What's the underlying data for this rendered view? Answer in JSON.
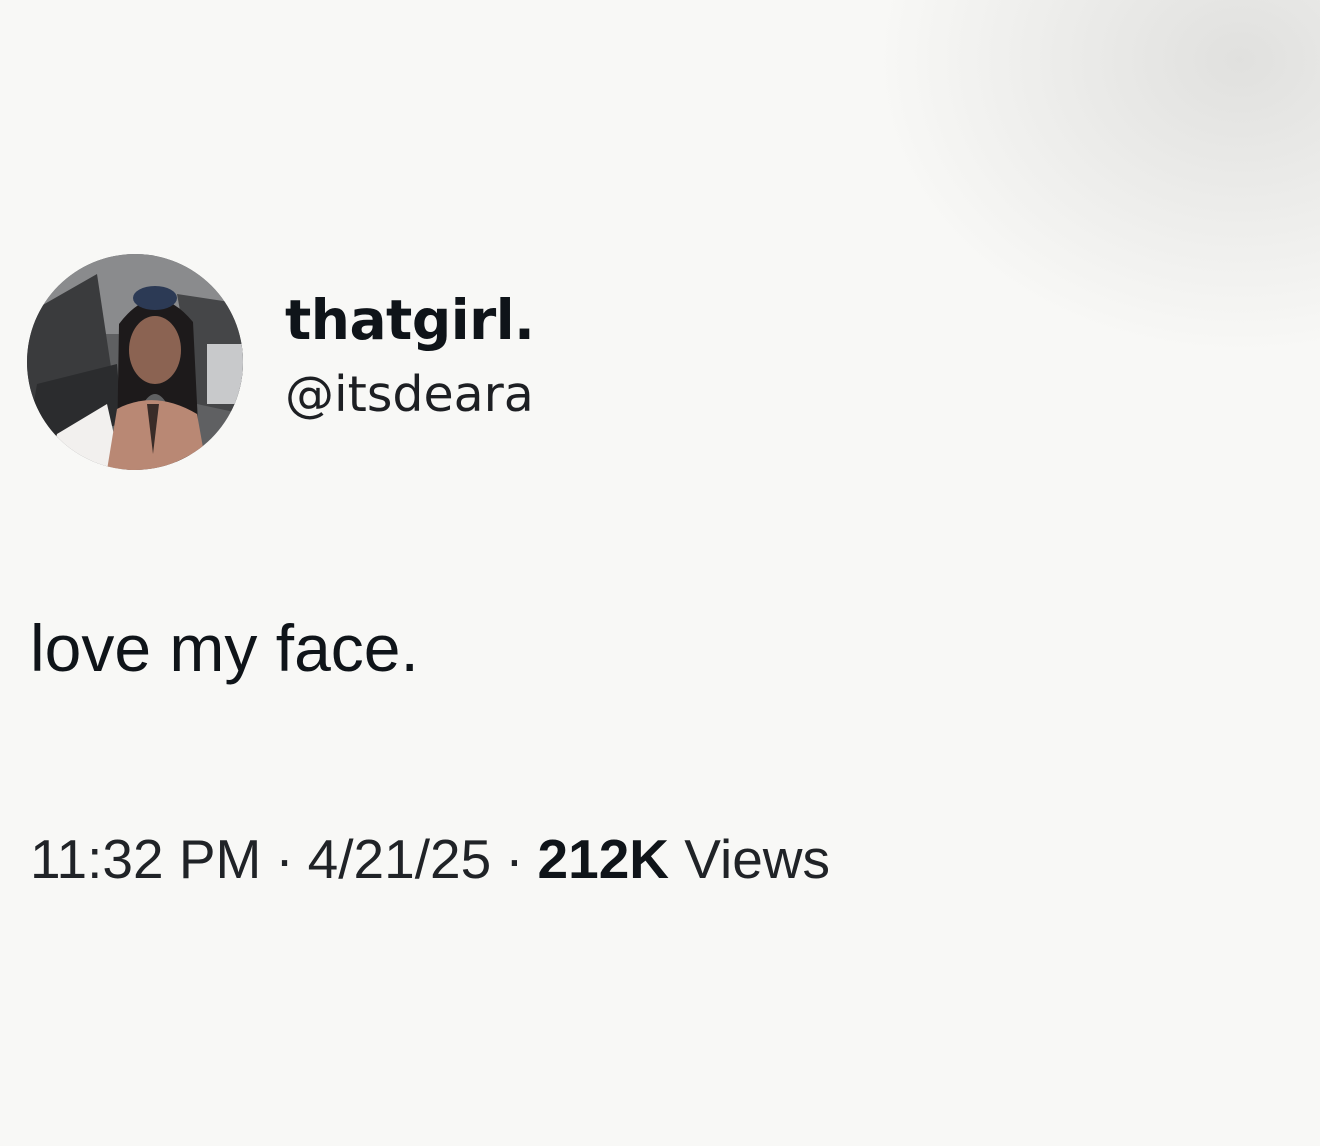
{
  "tweet": {
    "author": {
      "display_name": "thatgirl.",
      "handle": "@itsdeara"
    },
    "text": "love my face.",
    "time": "11:32 PM",
    "separator": "·",
    "date": "4/21/25",
    "views_count": "212K",
    "views_label": "Views"
  }
}
